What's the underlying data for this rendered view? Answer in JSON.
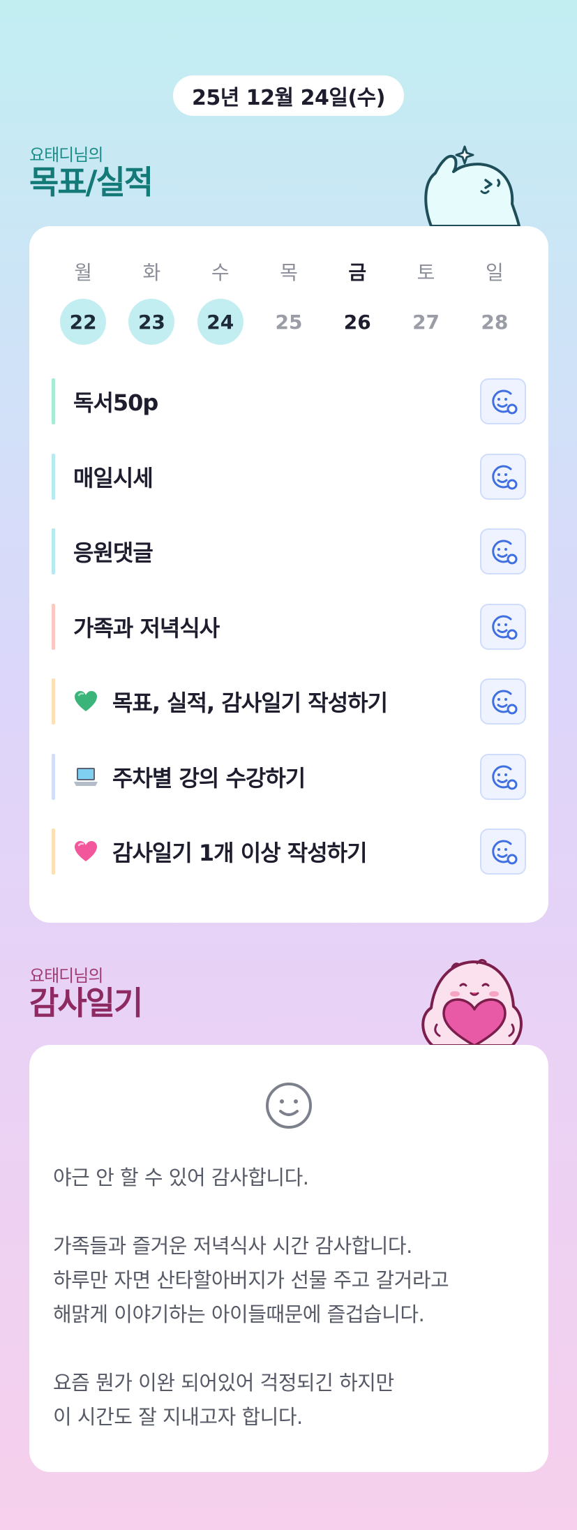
{
  "date": "25년 12월 24일(수)",
  "goals_section": {
    "subtitle": "요태디님의",
    "title": "목표/실적"
  },
  "week": [
    {
      "name": "월",
      "date": "22",
      "state": "done"
    },
    {
      "name": "화",
      "date": "23",
      "state": "done"
    },
    {
      "name": "수",
      "date": "24",
      "state": "done"
    },
    {
      "name": "목",
      "date": "25",
      "state": "future"
    },
    {
      "name": "금",
      "date": "26",
      "state": "highlight"
    },
    {
      "name": "토",
      "date": "27",
      "state": "future"
    },
    {
      "name": "일",
      "date": "28",
      "state": "future"
    }
  ],
  "goals": [
    {
      "text": "독서50p",
      "bar_color": "#a9ead2",
      "emoji": "",
      "action_icon": "smiley-add-icon"
    },
    {
      "text": "매일시세",
      "bar_color": "#b6eaf0",
      "emoji": "",
      "action_icon": "smiley-add-icon"
    },
    {
      "text": "응원댓글",
      "bar_color": "#b6eaf0",
      "emoji": "",
      "action_icon": "smiley-add-icon"
    },
    {
      "text": "가족과 저녁식사",
      "bar_color": "#fbc8c2",
      "emoji": "",
      "action_icon": "smiley-add-icon"
    },
    {
      "text": "목표, 실적, 감사일기 작성하기",
      "bar_color": "#fde0b4",
      "emoji": "green-heart",
      "action_icon": "smiley-add-icon"
    },
    {
      "text": "주차별 강의 수강하기",
      "bar_color": "#d3ddf8",
      "emoji": "laptop",
      "action_icon": "smiley-add-icon"
    },
    {
      "text": "감사일기 1개 이상 작성하기",
      "bar_color": "#fde0b4",
      "emoji": "pink-heart",
      "action_icon": "smiley-add-icon"
    }
  ],
  "gratitude_section": {
    "subtitle": "요태디님의",
    "title": "감사일기"
  },
  "gratitude": {
    "mood_icon": "smiley-icon",
    "text": "야근 안 할 수 있어 감사합니다.\n\n가족들과 즐거운 저녁식사 시간 감사합니다.\n하루만 자면 산타할아버지가 선물 주고 갈거라고\n해맑게 이야기하는 아이들때문에 즐겁습니다.\n\n요즘 뭔가 이완 되어있어 걱정되긴 하지만\n이 시간도 잘 지내고자 합니다."
  },
  "colors": {
    "accent_teal": "#147a78",
    "accent_plum": "#8d2a62",
    "done_circle": "#c3eef1",
    "icon_blue": "#3f6fe0"
  }
}
